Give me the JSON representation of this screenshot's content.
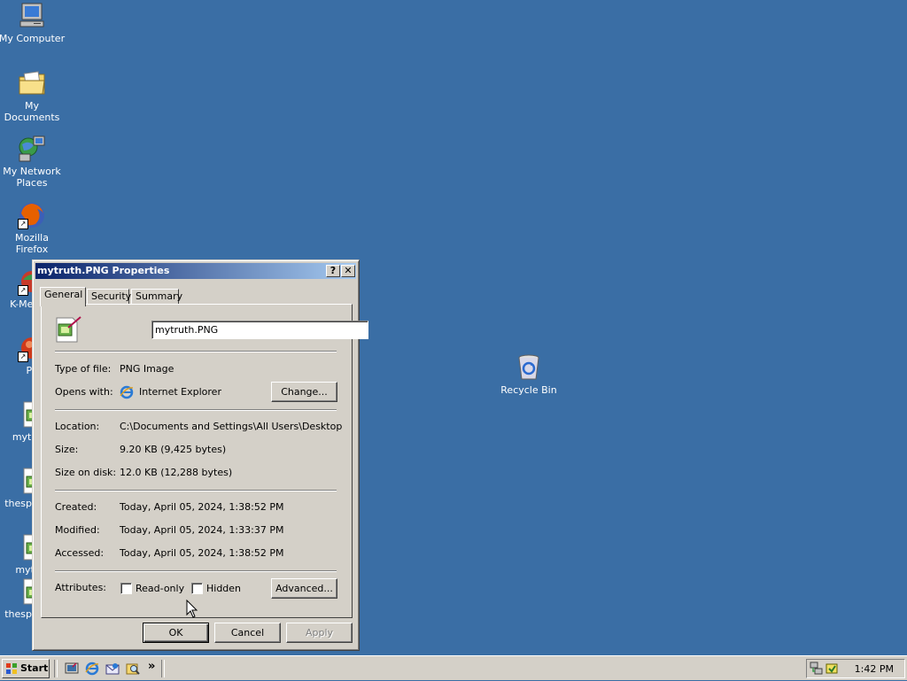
{
  "desktop": {
    "icons": [
      {
        "label": "My Computer"
      },
      {
        "label": "My Documents"
      },
      {
        "label": "My Network Places"
      },
      {
        "label": "Mozilla Firefox"
      },
      {
        "label": "K-Meleon"
      },
      {
        "label": "Pe"
      },
      {
        "label": "mytruth"
      },
      {
        "label": "thesp pain."
      },
      {
        "label": "mytrut"
      },
      {
        "label": "thesp pain."
      },
      {
        "label": "Recycle Bin"
      }
    ]
  },
  "dialog": {
    "title": "mytruth.PNG Properties",
    "help_glyph": "?",
    "close_glyph": "✕",
    "tabs": [
      {
        "label": "General"
      },
      {
        "label": "Security"
      },
      {
        "label": "Summary"
      }
    ],
    "filename": "mytruth.PNG",
    "type_label": "Type of file:",
    "type_value": "PNG Image",
    "opens_label": "Opens with:",
    "opens_value": "Internet Explorer",
    "change_label": "Change...",
    "location_label": "Location:",
    "location_value": "C:\\Documents and Settings\\All Users\\Desktop",
    "size_label": "Size:",
    "size_value": "9.20 KB (9,425 bytes)",
    "size_disk_label": "Size on disk:",
    "size_disk_value": "12.0 KB (12,288 bytes)",
    "created_label": "Created:",
    "created_value": "Today, April 05, 2024, 1:38:52 PM",
    "modified_label": "Modified:",
    "modified_value": "Today, April 05, 2024, 1:33:37 PM",
    "accessed_label": "Accessed:",
    "accessed_value": "Today, April 05, 2024, 1:38:52 PM",
    "attributes_label": "Attributes:",
    "readonly_label": "Read-only",
    "hidden_label": "Hidden",
    "advanced_label": "Advanced...",
    "ok_label": "OK",
    "cancel_label": "Cancel",
    "apply_label": "Apply"
  },
  "taskbar": {
    "start_label": "Start",
    "chevron": "»",
    "clock": "1:42 PM"
  }
}
